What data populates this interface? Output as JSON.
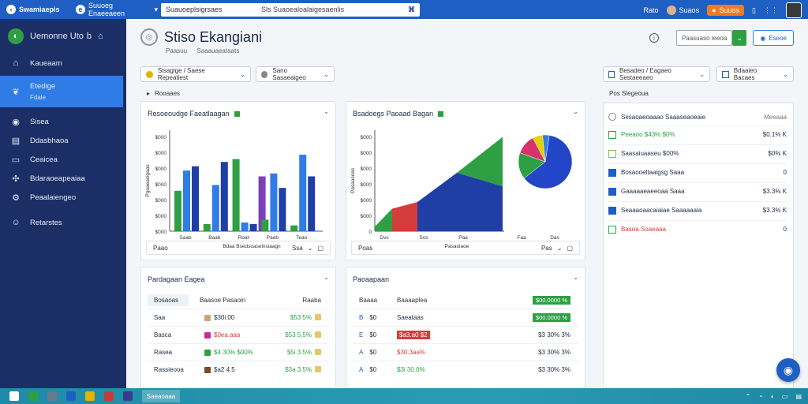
{
  "topbar": {
    "brand": "Swamiaepis",
    "workspace_icon": "e",
    "workspace": "Suuoeg Enaeeaeen",
    "url_left": "Suauoeplsigrsaes",
    "url_right": "Sls Suaoealoalaigesaenlis",
    "user_short": "Rato",
    "user_name": "Suaos",
    "orange_btn": "Suuos"
  },
  "sidebar": {
    "title": "Uemonne Uto",
    "title_suffix": "b",
    "items": [
      {
        "label": "Kaueaam",
        "icon": "home-icon"
      },
      {
        "label": "Etedige",
        "sub": "Fdale",
        "icon": "leaf-icon",
        "active": true
      },
      {
        "label": "Sisea",
        "icon": "layers-icon"
      },
      {
        "label": "Ddasbhaoa",
        "icon": "inbox-icon"
      },
      {
        "label": "Ceaicea",
        "icon": "folder-icon"
      },
      {
        "label": "Bdaraoeapeaiaa",
        "icon": "puzzle-icon"
      },
      {
        "label": "Peaalaiengeo",
        "icon": "gear-icon"
      },
      {
        "label": "Retarstes",
        "icon": "user-icon"
      }
    ]
  },
  "page": {
    "title": "Stiso Ekangiani",
    "subtitle_a": "Paasuu",
    "subtitle_b": "Saaauaeataats",
    "sort_btn": "Paasuaso ieeoa",
    "export_btn": "Eseoe"
  },
  "filters": {
    "f1": "Sisagige / Saese Repeatiest",
    "f2": "Sano Sasaeaigeo",
    "f3": "Besadeo / Eagaeo Sestaeeaeo",
    "f4": "Bdaaieo Bacaes"
  },
  "sections": {
    "left_label": "Rooaaes",
    "right_label": "Pos Slegeoua"
  },
  "bar_card": {
    "title": "Rosoeoudge Faeatlaagan",
    "foot_left": "Paao",
    "foot_right": "Ssa"
  },
  "area_card": {
    "title": "Bsadoegs Paoaad Bagan",
    "foot_left": "Poas",
    "foot_right": "Pas"
  },
  "chart_data": [
    {
      "type": "bar",
      "title": "Rosoeoudge Faeatlaagan",
      "xlabel": "Bdaa Bsedsoaselnsiaagn",
      "ylabel": "Pgoaeasigaas",
      "y_ticks": [
        "$000",
        "$000",
        "$000",
        "$000",
        "$000",
        "$000",
        "$000"
      ],
      "categories": [
        "Saab",
        "Baab",
        "Roat",
        "Paeb",
        "Teao"
      ],
      "ylim": [
        0,
        7
      ],
      "series": [
        {
          "color": "#2ea043",
          "values": [
            2.8,
            0.5,
            5.0,
            0.8,
            0.4
          ]
        },
        {
          "color": "#2f7ce6",
          "values": [
            4.2,
            3.2,
            0.6,
            4.0,
            5.3
          ]
        },
        {
          "color": "#1f3fa6",
          "values": [
            4.5,
            4.8,
            0.5,
            3.0,
            3.8
          ]
        },
        {
          "color": "#7b3fb8",
          "values": [
            0,
            0,
            3.8,
            0,
            0
          ]
        }
      ]
    },
    {
      "type": "area",
      "title": "Bsadoegs Paoaad Bagan",
      "xlabel": "Pasaoiaoe",
      "ylabel": "Pasaasoas",
      "y_ticks": [
        "$000",
        "$000",
        "$000",
        "$000",
        "$000",
        "$000",
        "0"
      ],
      "categories": [
        "Dvs",
        "Sos",
        "Paa",
        "Faa",
        "Das"
      ],
      "series": [
        {
          "color": "#2ea043",
          "values": [
            1.0,
            0,
            0,
            0,
            0
          ]
        },
        {
          "color": "#d63b3b",
          "values": [
            0,
            1.2,
            0,
            0,
            0
          ]
        },
        {
          "color": "#1f3fa6",
          "values": [
            0,
            0,
            2.5,
            1.8,
            0
          ]
        },
        {
          "color": "#2ea043",
          "values": [
            0,
            0,
            3.2,
            4.2,
            0
          ]
        }
      ]
    },
    {
      "type": "pie",
      "slices": [
        {
          "color": "#2345c8",
          "value": 62
        },
        {
          "color": "#2ea043",
          "value": 16
        },
        {
          "color": "#d6336c",
          "value": 12
        },
        {
          "color": "#e5d000",
          "value": 6
        },
        {
          "color": "#2f7ce6",
          "value": 4
        }
      ]
    }
  ],
  "table1": {
    "title": "Pardagaan Eagea",
    "headers": [
      "Bosaoas",
      "Baasoe Pasaoin",
      "Raaba"
    ],
    "rows": [
      {
        "name": "Saa",
        "color": "#c9a57a",
        "label": "$30i.00",
        "value": "$53 5%"
      },
      {
        "name": "Basca",
        "color": "#c02e9a",
        "label": "$0ea.aaa",
        "value": "$53 5.5%"
      },
      {
        "name": "Rasea",
        "color": "#2ea043",
        "label": "$4 30% $00%",
        "value": "$5i 3.5%"
      },
      {
        "name": "Rassieooa",
        "color": "#7a4a2a",
        "label": "$a2 4.5",
        "value": "$3a 3.5%"
      }
    ]
  },
  "table2": {
    "title": "Paoaapaan",
    "headers": [
      "Baaaa",
      "Baaaaplea",
      "$00.0000 %"
    ],
    "rows": [
      {
        "icon": "B",
        "name": "$0",
        "label": "Saeataas",
        "value": "$00.0000 %"
      },
      {
        "icon": "E",
        "name": "$0",
        "label": "$a3.a0 $2",
        "value": "$3 30% 3%"
      },
      {
        "icon": "A",
        "name": "$0",
        "label": "$30.3aa%",
        "value": "$3 30% 3%"
      },
      {
        "icon": "A",
        "name": "$0",
        "label": "$3i 30.0%",
        "value": "$3 30% 3%"
      }
    ]
  },
  "right_panel": {
    "header": "Sesaoaeoaaao Saaaseaoeaie",
    "header_val": "Meeaaa",
    "rows": [
      {
        "text": "Peeaoo $43% $0%",
        "value": "$0.1% K"
      },
      {
        "text": "Saasaiuaaseu $00%",
        "value": "$0% K"
      },
      {
        "text": "Bosaooeltaaigsg Saaa",
        "value": "0"
      },
      {
        "text": "Gaaaaaeaeeoaa Saaa",
        "value": "$3.3% K"
      },
      {
        "text": "Seaaaoaacaiaiae Saaaaaala",
        "value": "$3.3% K"
      },
      {
        "text": "Basoa Soaeaaa",
        "value": "0"
      }
    ]
  },
  "taskbar": {
    "app": "Saeaoaaa"
  }
}
